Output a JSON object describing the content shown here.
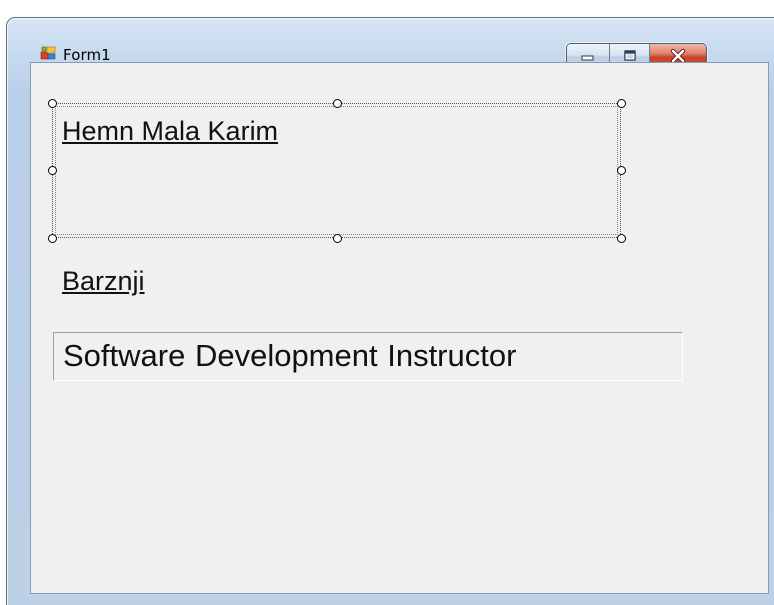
{
  "window": {
    "title": "Form1",
    "icon": "winforms-form-icon",
    "buttons": {
      "minimize": "minimize-icon",
      "maximize": "maximize-icon",
      "close": "close-icon"
    }
  },
  "form": {
    "label1": "Hemn Mala Karim",
    "label2": "Barznji",
    "label3": "Software Development  Instructor"
  },
  "colors": {
    "close_button": "#c7412a",
    "client_background": "#f0f0f0"
  }
}
